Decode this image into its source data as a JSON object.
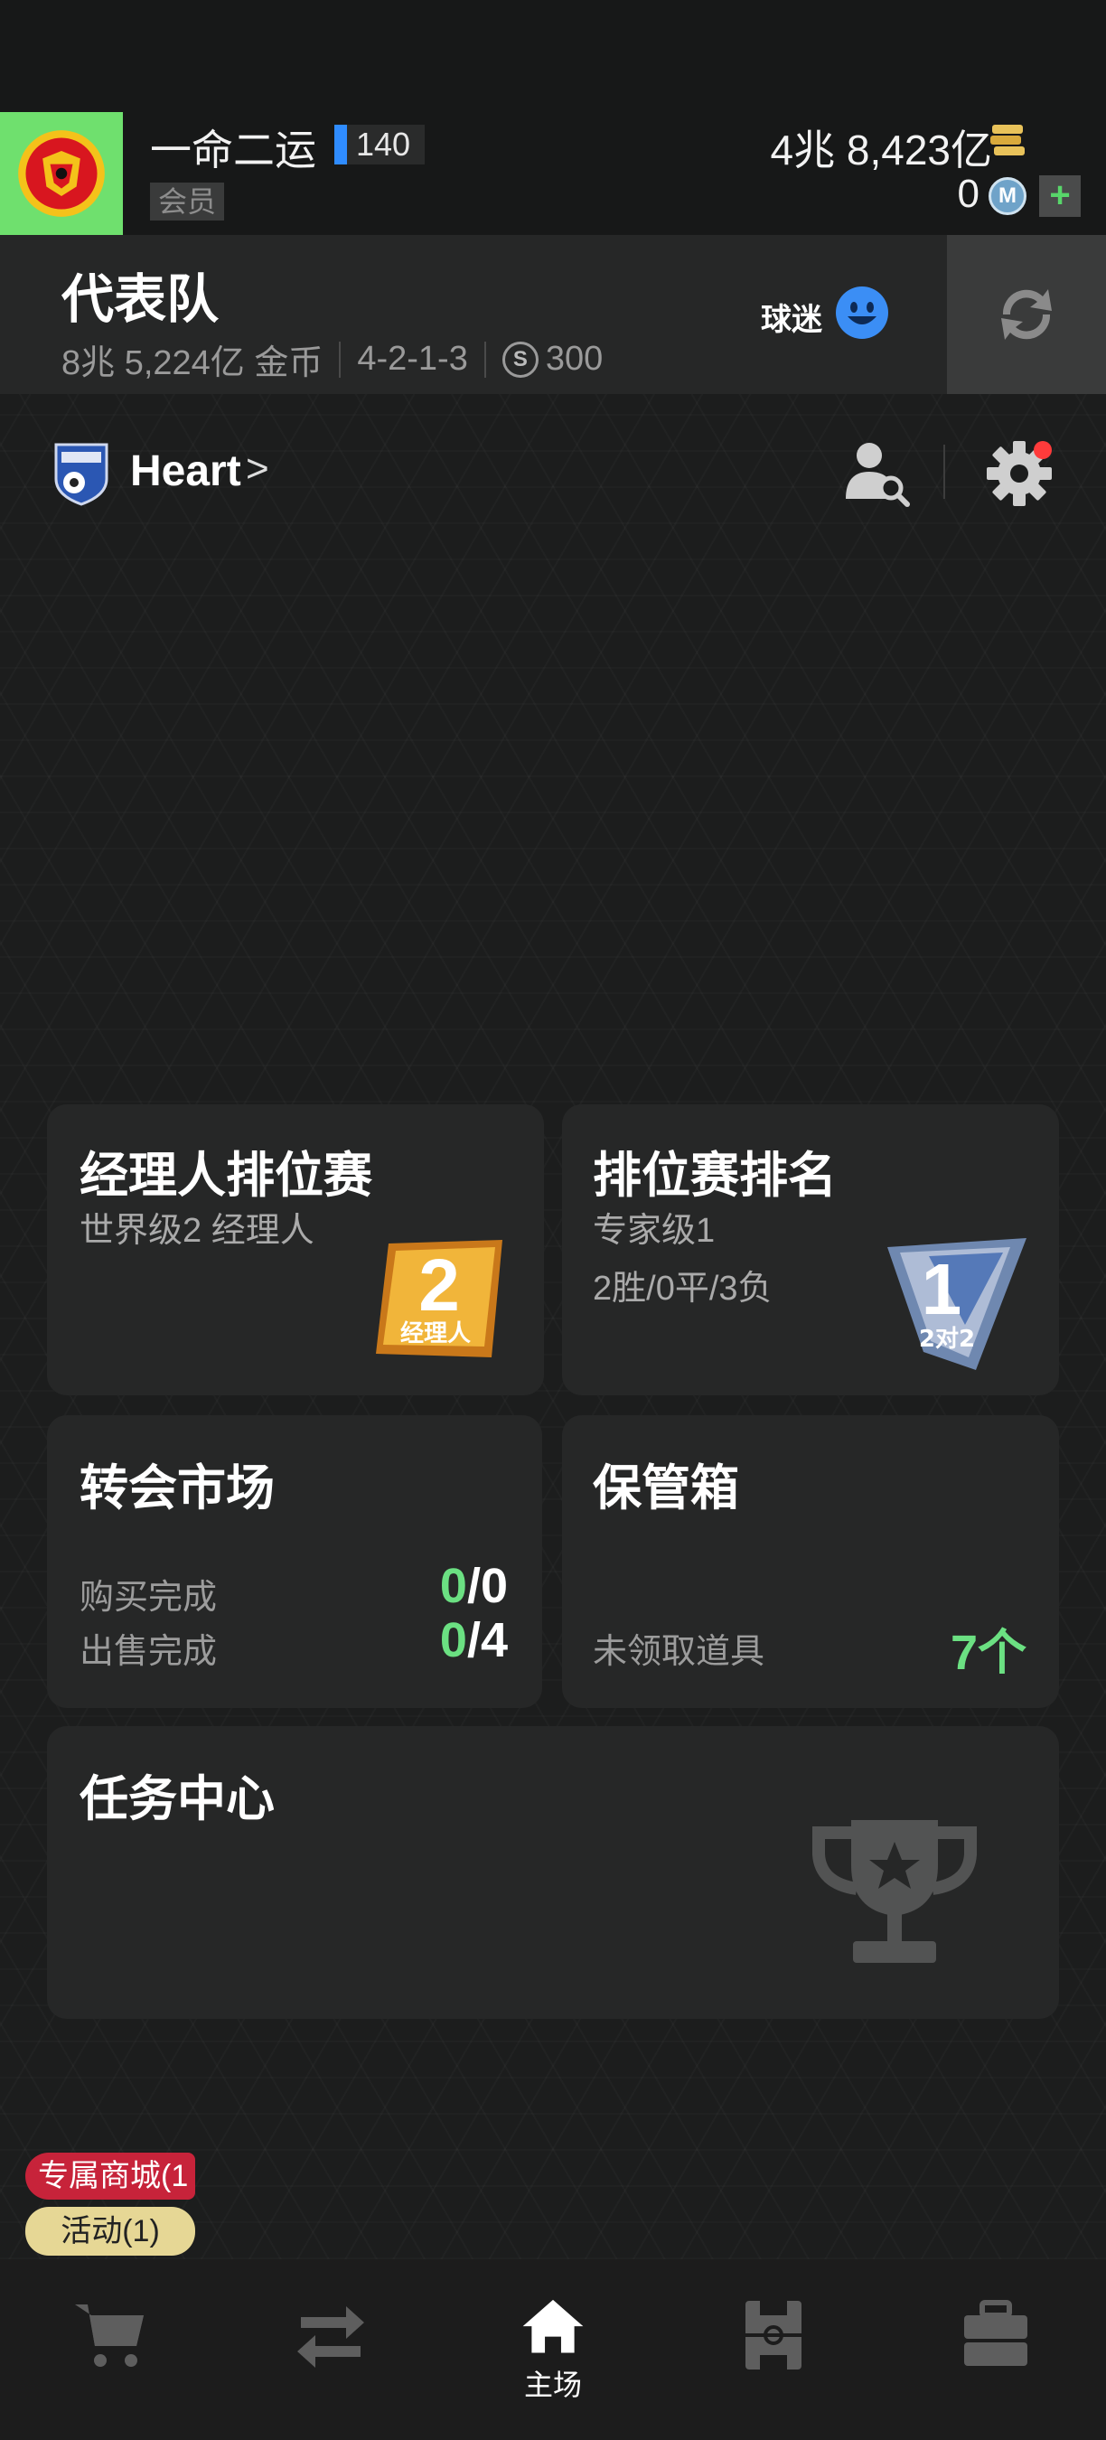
{
  "user": {
    "name": "一命二运",
    "level": "140",
    "member_label": "会员",
    "coins": "4兆 8,423亿",
    "mcoins": "0"
  },
  "squad": {
    "title": "代表队",
    "value": "8兆 5,224亿 金币",
    "formation": "4-2-1-3",
    "salary": "300",
    "fans_label": "球迷"
  },
  "team": {
    "name": "Heart",
    "chevron": ">"
  },
  "cards": {
    "manager_rank": {
      "title": "经理人排位赛",
      "subtitle": "世界级2 经理人",
      "badge_number": "2",
      "badge_text": "经理人"
    },
    "ranking": {
      "title": "排位赛排名",
      "subtitle": "专家级1",
      "record": "2胜/0平/3负",
      "badge_number": "1",
      "badge_text": "2对2"
    },
    "transfer": {
      "title": "转会市场",
      "buy_label": "购买完成",
      "buy_done": "0",
      "buy_total": "/0",
      "sell_label": "出售完成",
      "sell_done": "0",
      "sell_total": "/4"
    },
    "storage": {
      "title": "保管箱",
      "label": "未领取道具",
      "count": "7个"
    },
    "missions": {
      "title": "任务中心"
    }
  },
  "promos": {
    "shop": "专属商城(1",
    "event": "活动(1)"
  },
  "nav": {
    "home_label": "主场"
  },
  "icons": [
    "club-crest-icon",
    "gold-coin-icon",
    "m-coin-icon",
    "plus-icon",
    "swap-icon",
    "fan-face-icon",
    "team-crest-icon",
    "scout-search-icon",
    "gear-icon",
    "trophy-icon",
    "cart-icon",
    "transfer-arrows-icon",
    "home-icon",
    "pitch-icon",
    "briefcase-icon"
  ],
  "colors": {
    "accent_green": "#6be082",
    "member_green": "#6fe06e",
    "alert_red": "#ff3b3b",
    "level_blue": "#2f8cff"
  }
}
